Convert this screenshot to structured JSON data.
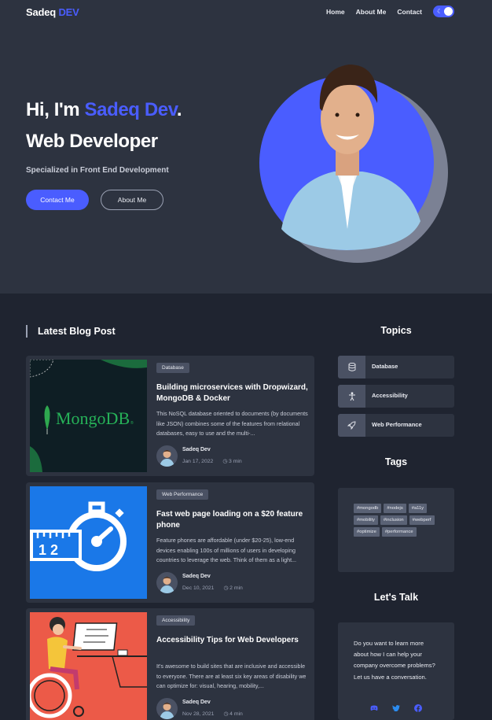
{
  "nav": {
    "logo_main": "Sadeq",
    "logo_accent": "DEV",
    "links": [
      "Home",
      "About Me",
      "Contact"
    ],
    "theme_toggle_icon": "moon-icon"
  },
  "hero": {
    "greeting_prefix": "Hi, I'm",
    "name": "Sadeq Dev",
    "greeting_suffix": ".",
    "role": "Web Developer",
    "subtitle": "Specialized in Front End Development",
    "primary_button": "Contact Me",
    "secondary_button": "About Me",
    "colors": {
      "accent": "#4a5dff",
      "hero_bg": "#2d3340"
    }
  },
  "blog": {
    "section_title": "Latest Blog Post",
    "posts": [
      {
        "badge": "Database",
        "title": "Building microservices with Dropwizard, MongoDB & Docker",
        "excerpt": "This NoSQL database oriented to documents (by documents like JSON) combines some of the features from relational databases, easy to use and the multi-...",
        "author": "Sadeq Dev",
        "date": "Jan 17, 2022",
        "read_time": "3 min",
        "thumb_text": "MongoDB",
        "thumb_trademark": "®"
      },
      {
        "badge": "Web Performance",
        "title": "Fast web page loading on a $20 feature phone",
        "excerpt": "Feature phones are affordable (under $20-25), low-end devices enabling 100s of millions of users in developing countries to leverage the web. Think of them as a light...",
        "author": "Sadeq Dev",
        "date": "Dec 10, 2021",
        "read_time": "2 min",
        "thumb_ruler_label": "1 2"
      },
      {
        "badge": "Accessibility",
        "title": "Accessibility Tips for Web Developers",
        "excerpt": "It's awesome to build sites that are inclusive and accessible to everyone. There are at least six key areas of disability we can optimize for: visual, hearing, mobility,...",
        "author": "Sadeq Dev",
        "date": "Nov 28, 2021",
        "read_time": "4 min"
      }
    ]
  },
  "sidebar": {
    "topics_title": "Topics",
    "topics": [
      {
        "label": "Database",
        "icon": "database-icon"
      },
      {
        "label": "Accessibility",
        "icon": "accessibility-icon"
      },
      {
        "label": "Web Performance",
        "icon": "rocket-icon"
      }
    ],
    "tags_title": "Tags",
    "tags": [
      "#mongodb",
      "#nodejs",
      "#a11y",
      "#mobility",
      "#inclusion",
      "#webperf",
      "#optimize",
      "#performance"
    ],
    "talk_title": "Let's Talk",
    "talk_text": "Do you want to learn more about how I can help your company overcome problems? Let us have a conversation.",
    "social_icons": [
      "discord-icon",
      "twitter-icon",
      "facebook-icon"
    ]
  }
}
